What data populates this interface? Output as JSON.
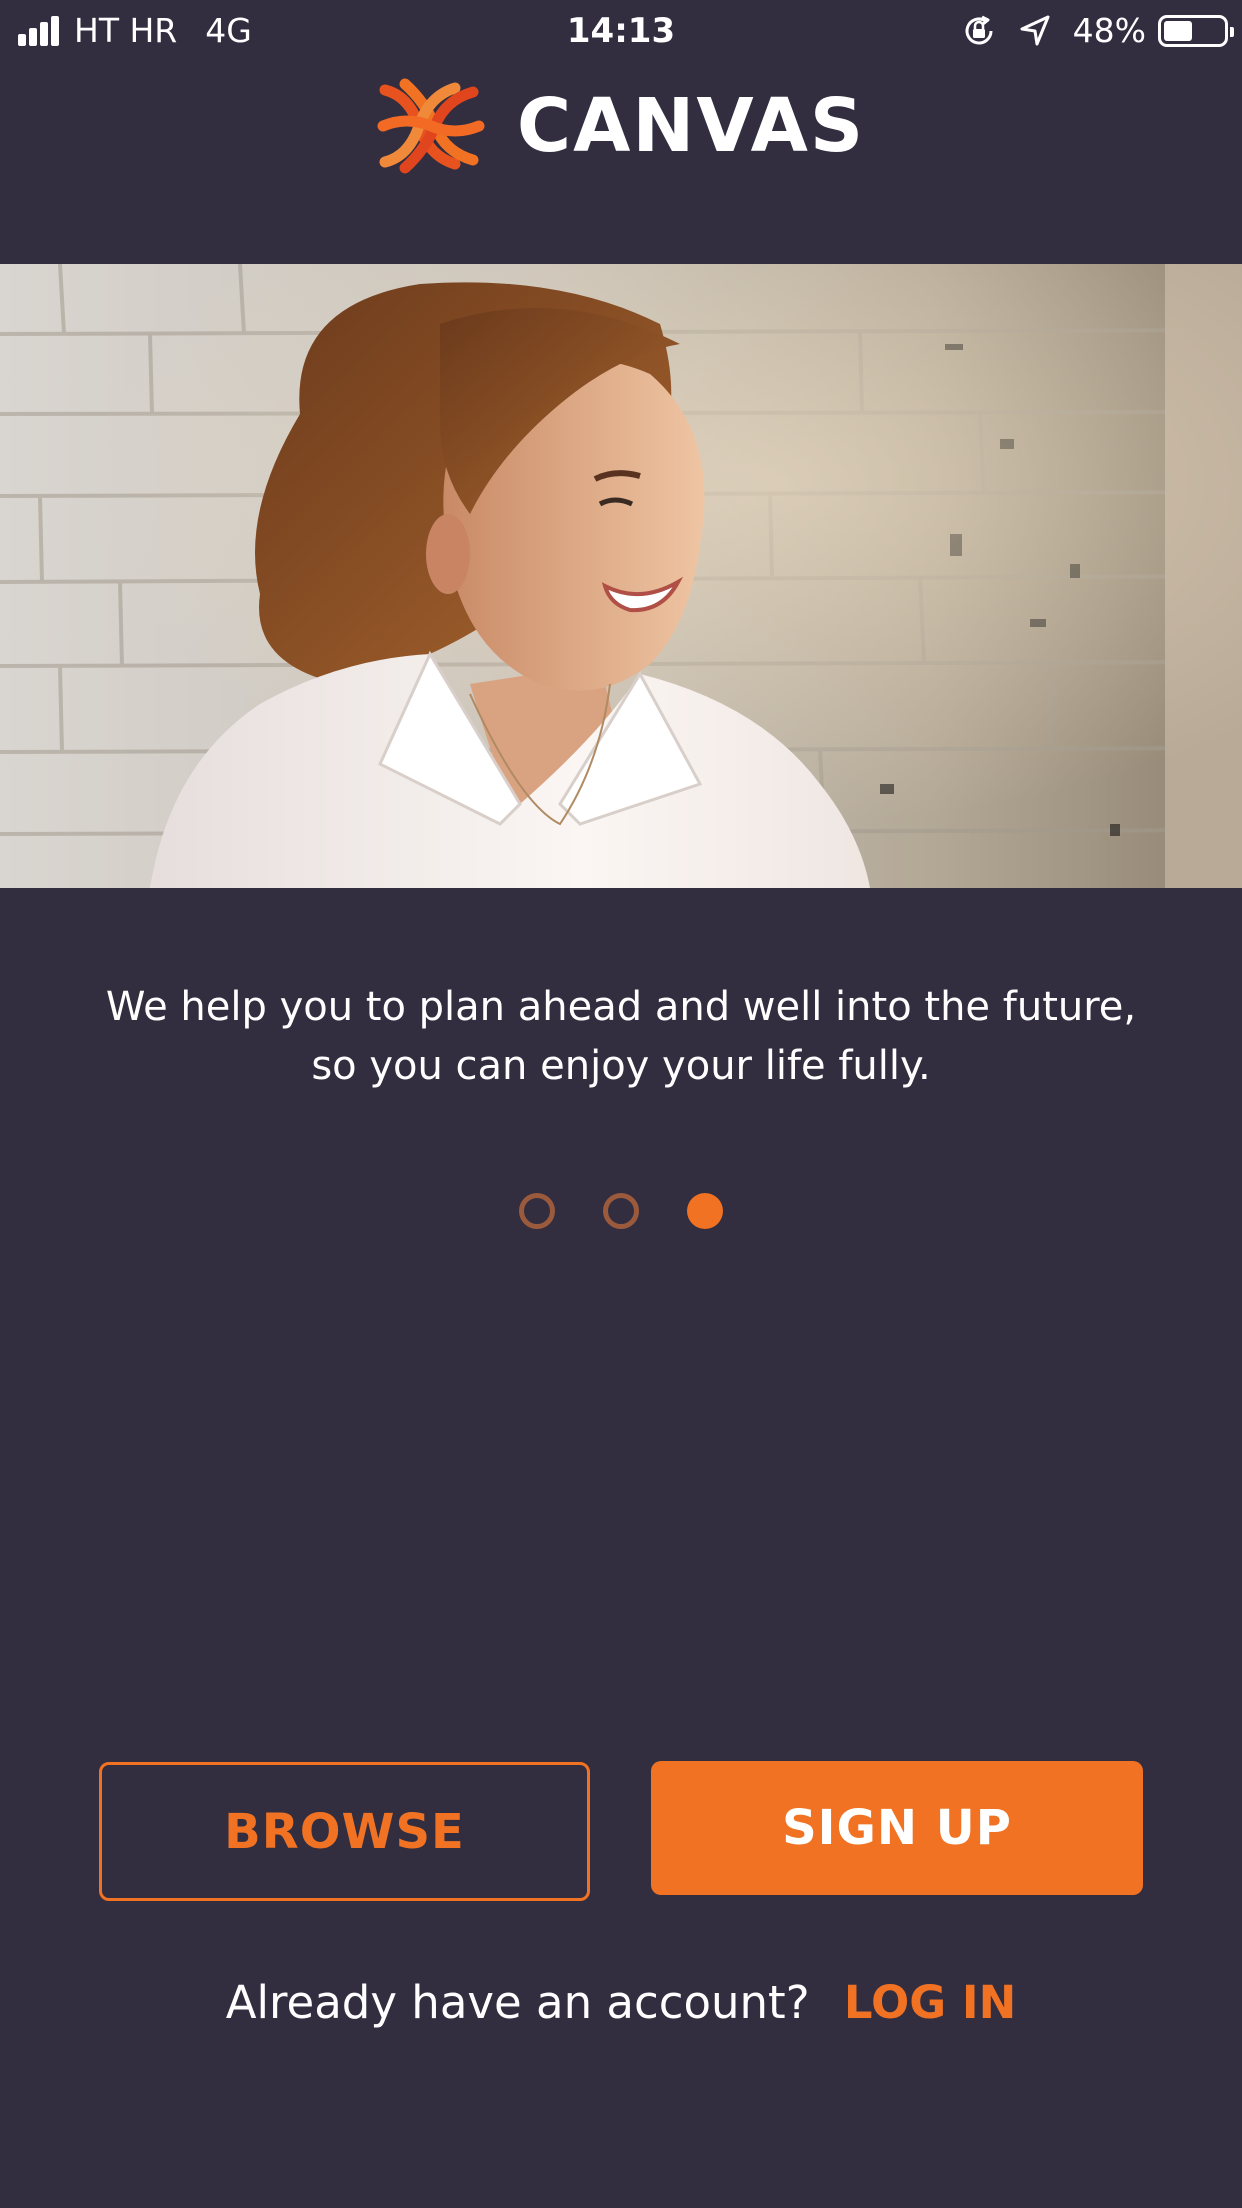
{
  "status_bar": {
    "carrier": "HT HR",
    "network": "4G",
    "time": "14:13",
    "battery_percent": "48%",
    "battery_level": 0.48,
    "icons": [
      "signal-bars-icon",
      "orientation-lock-icon",
      "location-arrow-icon",
      "battery-icon"
    ]
  },
  "brand": {
    "name": "CANVAS",
    "logo_icon": "canvas-logo-icon"
  },
  "hero": {
    "subject": "smiling woman in white blouse in front of a whitewashed brick wall"
  },
  "tagline": {
    "line1": "We help you to plan ahead and well into the future,",
    "line2": "so you can enjoy your life fully."
  },
  "pager": {
    "count": 3,
    "active_index": 2
  },
  "actions": {
    "browse_label": "BROWSE",
    "signup_label": "SIGN UP"
  },
  "login": {
    "prompt": "Already have an account?",
    "link_label": "LOG IN"
  },
  "colors": {
    "background": "#322e40",
    "accent": "#f07222",
    "dot_inactive": "#9b5a3c",
    "text": "#ffffff"
  }
}
